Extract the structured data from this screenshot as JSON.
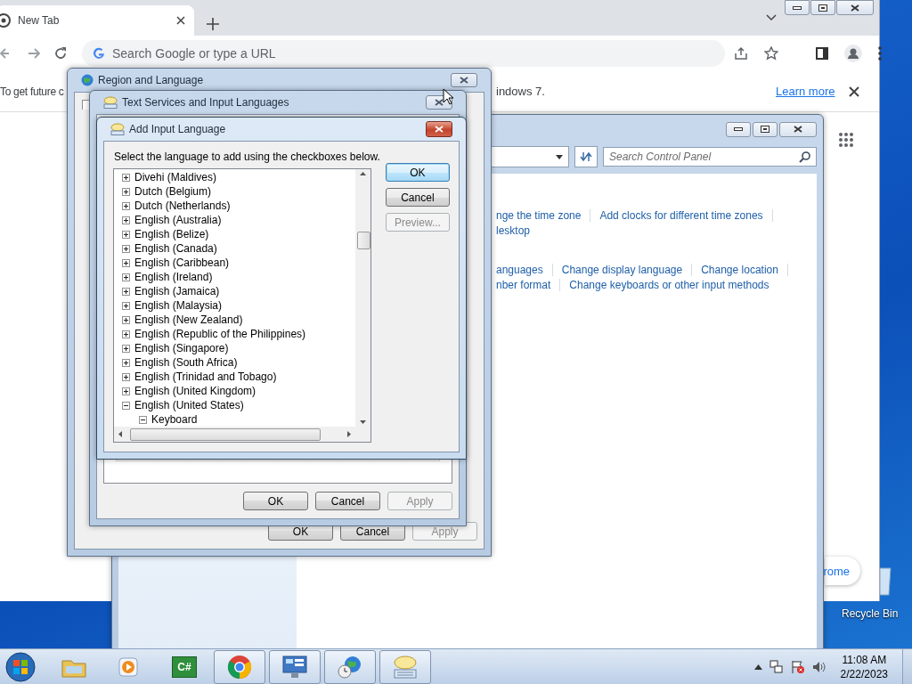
{
  "browser": {
    "tab": {
      "title": "New Tab"
    },
    "omnibox": {
      "placeholder": "Search Google or type a URL"
    },
    "infobar": {
      "text_left": "To get future c",
      "text_right": "indows 7.",
      "link": "Learn more"
    },
    "customize_button": {
      "label": "rome"
    }
  },
  "control_panel": {
    "search": {
      "placeholder": "Search Control Panel"
    },
    "link_groups": [
      {
        "lines": [
          [
            "nge the time zone",
            "Add clocks for different time zones"
          ],
          [
            "lesktop"
          ]
        ]
      },
      {
        "lines": [
          [
            "anguages",
            "Change display language",
            "Change location"
          ],
          [
            "nber format",
            "Change keyboards or other input methods"
          ]
        ]
      }
    ]
  },
  "region_dialog": {
    "title": "Region and Language",
    "buttons": [
      {
        "label": "OK",
        "disabled": false
      },
      {
        "label": "Cancel",
        "disabled": false
      },
      {
        "label": "Apply",
        "disabled": true
      }
    ]
  },
  "text_services_dialog": {
    "title": "Text Services and Input Languages",
    "buttons": [
      {
        "label": "OK",
        "disabled": false
      },
      {
        "label": "Cancel",
        "disabled": false
      },
      {
        "label": "Apply",
        "disabled": true
      }
    ]
  },
  "add_language_dialog": {
    "title": "Add Input Language",
    "instruction": "Select the language to add using the checkboxes below.",
    "buttons": [
      {
        "label": "OK",
        "default": true,
        "disabled": false
      },
      {
        "label": "Cancel",
        "default": false,
        "disabled": false
      },
      {
        "label": "Preview...",
        "default": false,
        "disabled": true
      }
    ],
    "tree": [
      {
        "label": "Divehi (Maldives)",
        "expanded": false
      },
      {
        "label": "Dutch (Belgium)",
        "expanded": false
      },
      {
        "label": "Dutch (Netherlands)",
        "expanded": false
      },
      {
        "label": "English (Australia)",
        "expanded": false
      },
      {
        "label": "English (Belize)",
        "expanded": false
      },
      {
        "label": "English (Canada)",
        "expanded": false
      },
      {
        "label": "English (Caribbean)",
        "expanded": false
      },
      {
        "label": "English (Ireland)",
        "expanded": false
      },
      {
        "label": "English (Jamaica)",
        "expanded": false
      },
      {
        "label": "English (Malaysia)",
        "expanded": false
      },
      {
        "label": "English (New Zealand)",
        "expanded": false
      },
      {
        "label": "English (Republic of the Philippines)",
        "expanded": false
      },
      {
        "label": "English (Singapore)",
        "expanded": false
      },
      {
        "label": "English (South Africa)",
        "expanded": false
      },
      {
        "label": "English (Trinidad and Tobago)",
        "expanded": false
      },
      {
        "label": "English (United Kingdom)",
        "expanded": false
      },
      {
        "label": "English (United States)",
        "expanded": true,
        "children": [
          {
            "label": "Keyboard",
            "expanded": true
          }
        ]
      }
    ]
  },
  "desktop": {
    "recycle_bin": {
      "label": "Recycle Bin"
    }
  },
  "taskbar": {
    "items": [
      {
        "kind": "explorer",
        "open": false
      },
      {
        "kind": "media",
        "open": false
      },
      {
        "kind": "csharp",
        "label": "C#",
        "open": false
      },
      {
        "kind": "chrome",
        "open": true
      },
      {
        "kind": "control-panel",
        "open": true
      },
      {
        "kind": "region",
        "open": true
      },
      {
        "kind": "text-services",
        "open": true
      }
    ],
    "time": "11:08 AM",
    "date": "2/22/2023"
  }
}
